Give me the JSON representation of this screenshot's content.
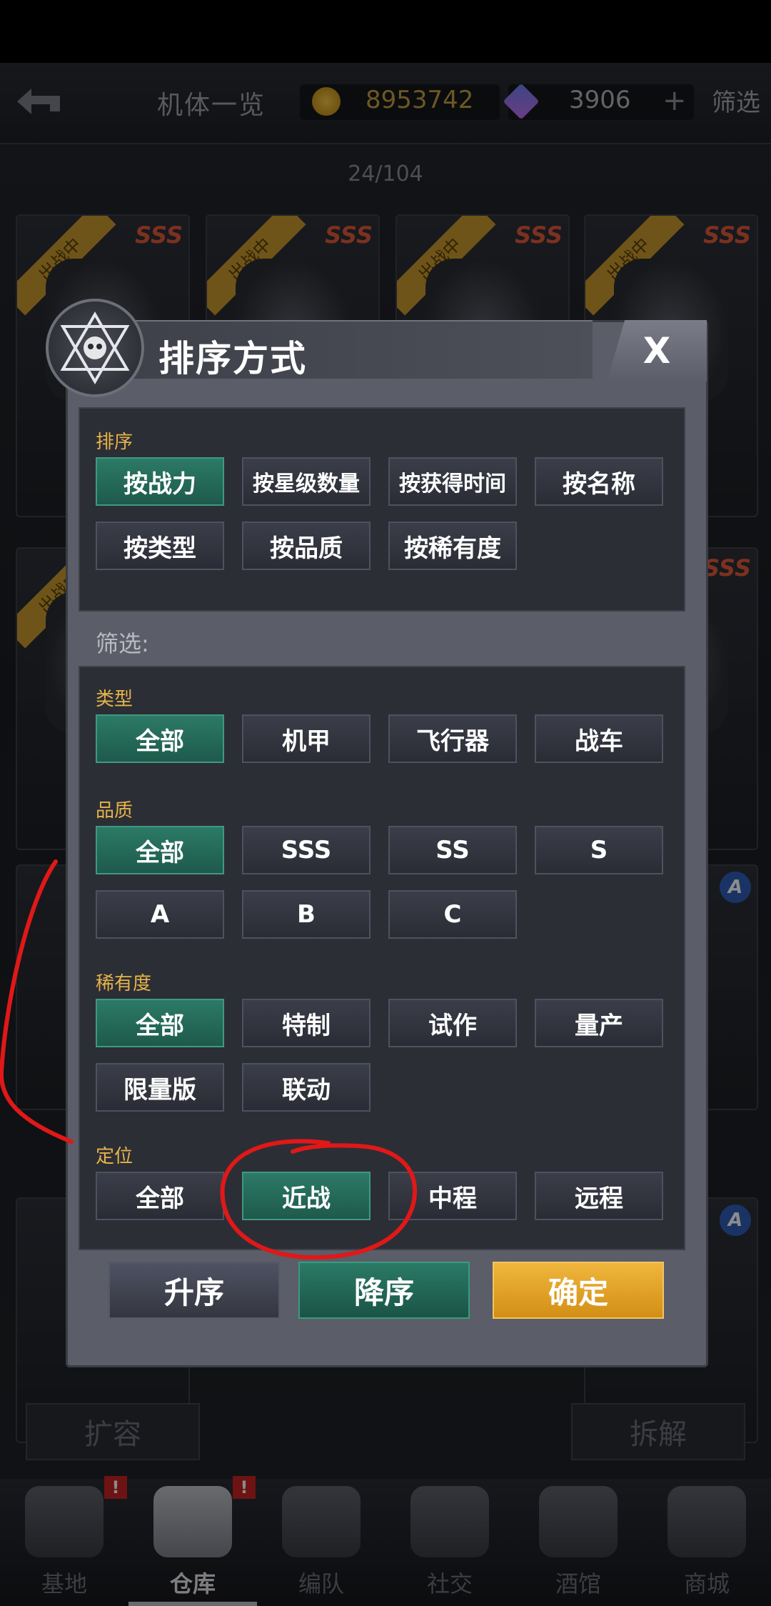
{
  "topbar": {
    "title": "机体一览",
    "coins": "8953742",
    "gems": "3906",
    "plus": "+",
    "filter": "筛选"
  },
  "counter": "24/104",
  "cards": {
    "ribbon": "出战中",
    "grade": "SSS",
    "badge": "A"
  },
  "dialog": {
    "title": "排序方式",
    "close": "X",
    "sort": {
      "label": "排序",
      "options": [
        "按战力",
        "按星级数量",
        "按获得时间",
        "按名称",
        "按类型",
        "按品质",
        "按稀有度"
      ],
      "selected": "按战力"
    },
    "filter_label": "筛选:",
    "type": {
      "label": "类型",
      "options": [
        "全部",
        "机甲",
        "飞行器",
        "战车"
      ],
      "selected": "全部"
    },
    "quality": {
      "label": "品质",
      "options": [
        "全部",
        "SSS",
        "SS",
        "S",
        "A",
        "B",
        "C"
      ],
      "selected": "全部"
    },
    "rarity": {
      "label": "稀有度",
      "options": [
        "全部",
        "特制",
        "试作",
        "量产",
        "限量版",
        "联动"
      ],
      "selected": "全部"
    },
    "position": {
      "label": "定位",
      "options": [
        "全部",
        "近战",
        "中程",
        "远程"
      ],
      "selected": "近战"
    },
    "asc": "升序",
    "desc": "降序",
    "confirm": "确定"
  },
  "bottom": {
    "expand": "扩容",
    "dismantle": "拆解"
  },
  "nav": [
    {
      "label": "基地",
      "icon": "base-icon"
    },
    {
      "label": "仓库",
      "icon": "warehouse-icon"
    },
    {
      "label": "编队",
      "icon": "formation-icon"
    },
    {
      "label": "社交",
      "icon": "social-icon"
    },
    {
      "label": "酒馆",
      "icon": "tavern-icon"
    },
    {
      "label": "商城",
      "icon": "shop-icon"
    }
  ],
  "nav_active": "仓库",
  "alert_mark": "!",
  "colors": {
    "selected": "#2c7a66",
    "accent_label": "#e5b34a",
    "confirm": "#f0b63d",
    "annotation": "#e01818"
  }
}
